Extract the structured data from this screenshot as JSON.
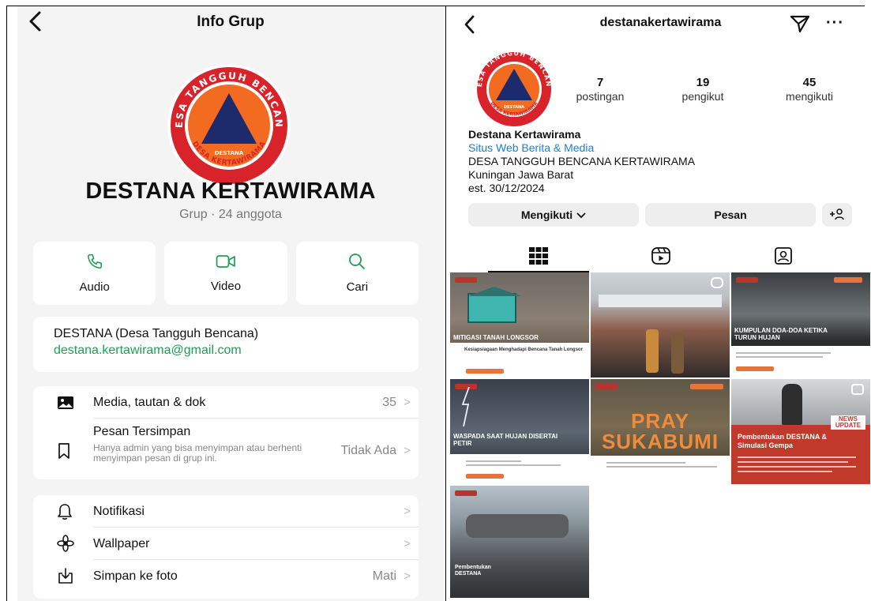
{
  "left": {
    "header": {
      "title": "Info Grup"
    },
    "logo": {
      "text_top": "DESA TANGGUH BENCANA",
      "text_center": "DESTANA",
      "text_bottom": "DESA KERTAWIRAMA"
    },
    "group": {
      "name": "DESTANA KERTAWIRAMA",
      "subtitle": "Grup · 24 anggota"
    },
    "actions": [
      {
        "label": "Audio",
        "icon": "phone-icon"
      },
      {
        "label": "Video",
        "icon": "video-icon"
      },
      {
        "label": "Cari",
        "icon": "search-icon"
      }
    ],
    "description": {
      "text": "DESTANA (Desa Tangguh Bencana)",
      "email": "destana.kertawirama@gmail.com"
    },
    "media_row": {
      "label": "Media, tautan & dok",
      "value": "35",
      "icon": "image-icon"
    },
    "saved_row": {
      "label": "Pesan Tersimpan",
      "note": "Hanya admin yang bisa menyimpan atau berhenti menyimpan pesan di grup ini.",
      "value": "Tidak Ada",
      "icon": "bookmark-icon"
    },
    "notif_row": {
      "label": "Notifikasi",
      "icon": "bell-icon"
    },
    "wallpaper_row": {
      "label": "Wallpaper",
      "icon": "flower-icon"
    },
    "save_photo_row": {
      "label": "Simpan ke foto",
      "value": "Mati",
      "icon": "download-icon"
    },
    "chevron": ">"
  },
  "right": {
    "header": {
      "username": "destanakertawirama",
      "more": "···"
    },
    "stats": [
      {
        "num": "7",
        "cap": "postingan"
      },
      {
        "num": "19",
        "cap": "pengikut"
      },
      {
        "num": "45",
        "cap": "mengikuti"
      }
    ],
    "bio": {
      "name": "Destana Kertawirama",
      "category": "Situs Web Berita & Media",
      "line1": "DESA TANGGUH BENCANA KERTAWIRAMA",
      "line2": "Kuningan Jawa Barat",
      "line3": "est. 30/12/2024"
    },
    "buttons": {
      "following": "Mengikuti",
      "message": "Pesan",
      "add": "+"
    },
    "posts": [
      {
        "caption": "MITIGASI TANAH LONGSOR",
        "sub": "Kesiapsiagaan Menghadapi Bencana Tanah Longsor"
      },
      {
        "caption": "",
        "sub": ""
      },
      {
        "caption": "KUMPULAN DOA-DOA KETIKA TURUN HUJAN",
        "sub": ""
      },
      {
        "caption": "WASPADA SAAT HUJAN DISERTAI PETIR",
        "sub": ""
      },
      {
        "caption": "PRAY SUKABUMI",
        "sub": ""
      },
      {
        "caption": "Pembentukan DESTANA & Simulasi Gempa",
        "sub": "",
        "badge": "NEWS UPDATE"
      },
      {
        "caption": "Pembentukan DESTANA",
        "sub": ""
      }
    ]
  },
  "colors": {
    "whatsapp_green": "#1f9d55",
    "instagram_link": "#1a7fd0",
    "logo_red": "#d8232a",
    "logo_orange": "#f26b21",
    "logo_navy": "#1d2a6b"
  }
}
